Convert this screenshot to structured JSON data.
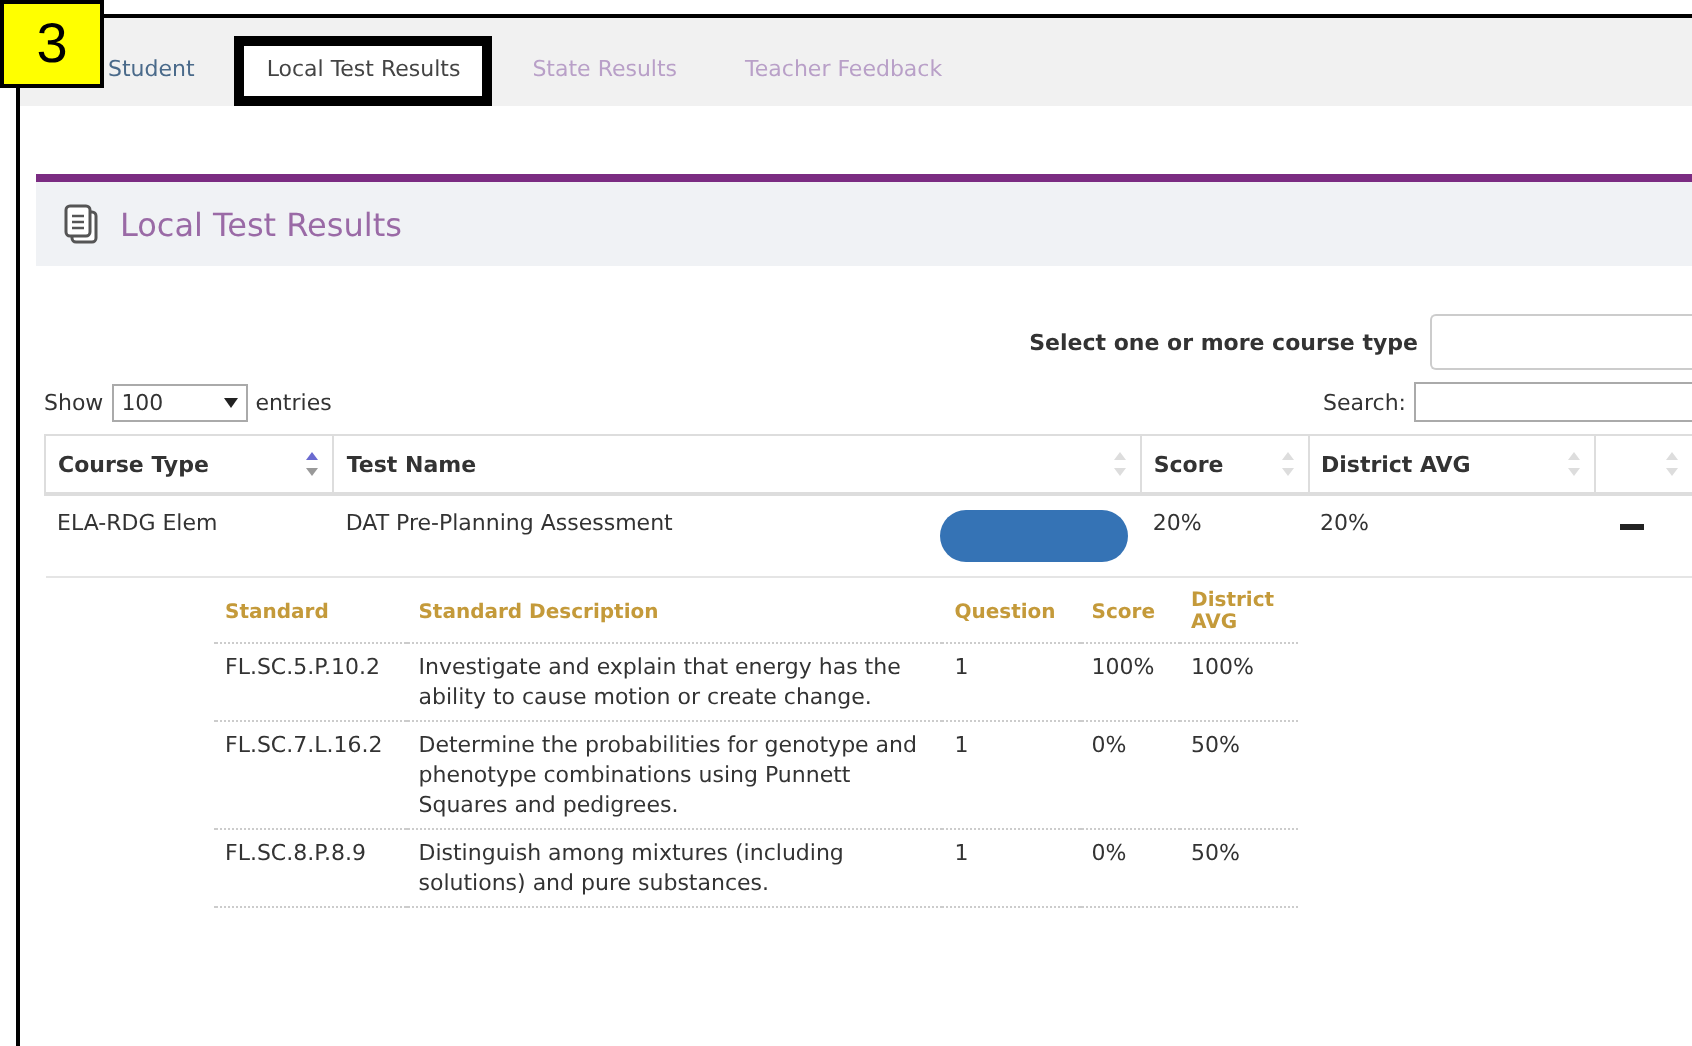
{
  "annotation": {
    "badge": "3"
  },
  "tabs": [
    {
      "label": "Student",
      "selected": false
    },
    {
      "label": "Local Test Results",
      "selected": true
    },
    {
      "label": "State Results",
      "selected": false
    },
    {
      "label": "Teacher Feedback",
      "selected": false
    }
  ],
  "panel": {
    "title": "Local Test Results"
  },
  "filter": {
    "label": "Select one or more course type"
  },
  "entries": {
    "prefix": "Show",
    "value": "100",
    "suffix": "entries"
  },
  "search": {
    "label": "Search:"
  },
  "table": {
    "columns": [
      "Course Type",
      "Test Name",
      "Score",
      "District AVG"
    ],
    "rows": [
      {
        "course_type": "ELA-RDG Elem",
        "test_name": "DAT Pre-Planning Assessment",
        "score": "20%",
        "district_avg": "20%",
        "expanded": true
      }
    ]
  },
  "details": {
    "columns": [
      "Standard",
      "Standard Description",
      "Question",
      "Score",
      "District AVG"
    ],
    "rows": [
      {
        "standard": "FL.SC.5.P.10.2",
        "description": "Investigate and explain that energy has the ability to cause motion or create change.",
        "question": "1",
        "score": "100%",
        "district_avg": "100%"
      },
      {
        "standard": "FL.SC.7.L.16.2",
        "description": "Determine the probabilities for genotype and phenotype combinations using Punnett Squares and pedigrees.",
        "question": "1",
        "score": "0%",
        "district_avg": "50%"
      },
      {
        "standard": "FL.SC.8.P.8.9",
        "description": "Distinguish among mixtures (including solutions) and pure substances.",
        "question": "1",
        "score": "0%",
        "district_avg": "50%"
      }
    ]
  }
}
